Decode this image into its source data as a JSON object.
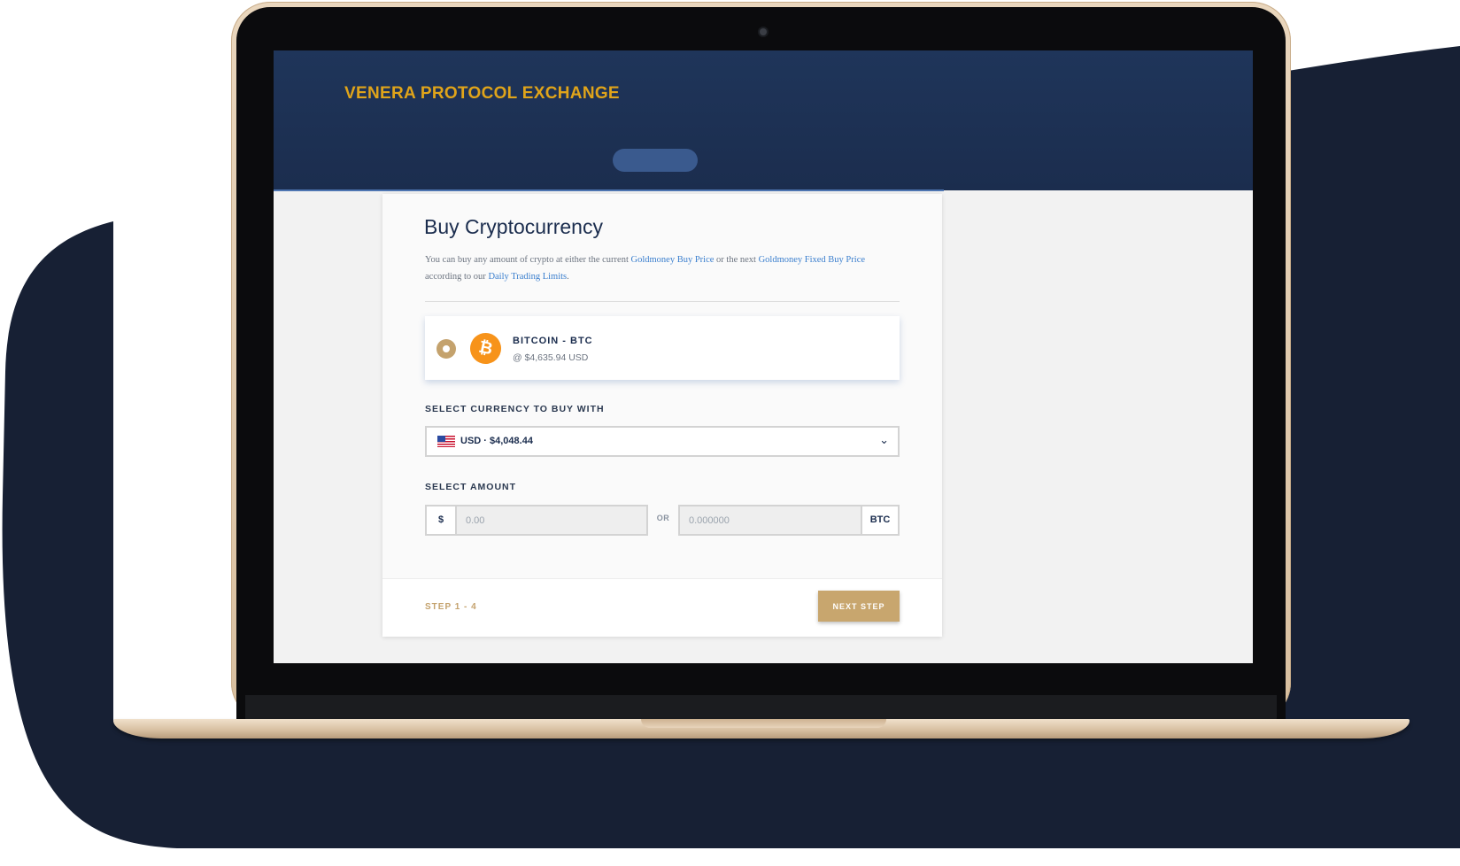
{
  "app": {
    "brand": "VENERA PROTOCOL EXCHANGE"
  },
  "card": {
    "title": "Buy Cryptocurrency",
    "description": {
      "part1": "You can buy any amount of crypto at either the current ",
      "link1": "Goldmoney Buy Price",
      "part2": " or the next ",
      "link2": "Goldmoney Fixed Buy Price",
      "part3": " according to our ",
      "link3": "Daily Trading Limits",
      "part4": "."
    },
    "coin": {
      "name": "BITCOIN - BTC",
      "price": "@ $4,635.94 USD",
      "symbol": "₿",
      "icon": "bitcoin-icon",
      "selected": true
    },
    "currency": {
      "label": "SELECT CURRENCY TO BUY WITH",
      "selected": "USD · $4,048.44",
      "icon": "us-flag-icon"
    },
    "amount": {
      "label": "SELECT AMOUNT",
      "fiat_prefix": "$",
      "fiat_placeholder": "0.00",
      "separator": "OR",
      "crypto_placeholder": "0.000000",
      "crypto_suffix": "BTC"
    },
    "footer": {
      "step": "STEP 1 - 4",
      "next_label": "NEXT STEP"
    }
  },
  "colors": {
    "header_bg": "#1f355a",
    "brand_text": "#e0a41a",
    "accent_gold": "#c8a66e",
    "link_blue": "#3b7fce",
    "bitcoin_orange": "#f7931a",
    "backdrop_navy": "#172034"
  }
}
